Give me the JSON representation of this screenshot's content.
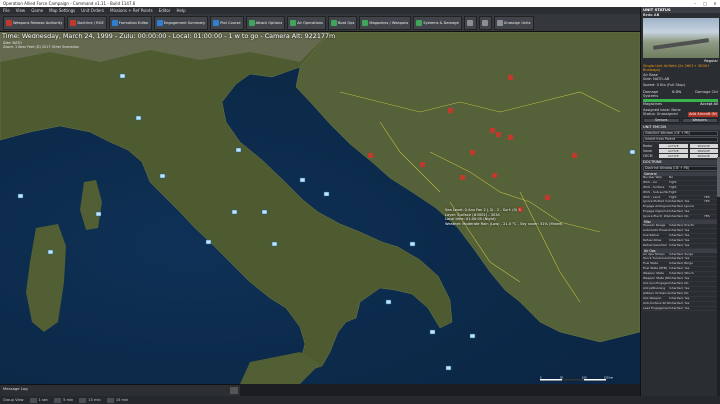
{
  "window": {
    "title": "Operation Allied Force Campaign - Command v1.11 - Build 1147.6",
    "controls": [
      "–",
      "□",
      "✕"
    ]
  },
  "menu": [
    "File",
    "View",
    "Game",
    "Map Settings",
    "Unit Orders",
    "Missions + Ref Points",
    "Editor",
    "Help"
  ],
  "toolbar": {
    "buttons": [
      {
        "label": "Weapons Release Authority",
        "color": "red"
      },
      {
        "label": "Doctrine / ROE",
        "color": "red"
      },
      {
        "label": "Formation Editor",
        "color": "blue"
      },
      {
        "label": "Engagement Summary",
        "color": "blue"
      },
      {
        "label": "Plot Course",
        "color": "blue"
      },
      {
        "label": "Attack Options",
        "color": "green"
      },
      {
        "label": "Air Operations",
        "color": "green"
      },
      {
        "label": "Boat Ops",
        "color": "green"
      },
      {
        "label": "Magazines / Weapons",
        "color": "green"
      },
      {
        "label": "Systems & Damage",
        "color": "green"
      },
      {
        "label": "",
        "color": "gray"
      },
      {
        "label": "",
        "color": "gray"
      },
      {
        "label": "Unassign Units",
        "color": "gray"
      }
    ]
  },
  "map": {
    "status": "Time: Wednesday, March 24, 1999 - Zulu: 00:00:00 - Local: 01:00:00 - 1 w to go - Camera Alt: 922177m",
    "sub_line1": "Side: NATO",
    "sub_line2": "Zoom: 1 Bear Feet (D) 2017 Other Scenarios",
    "tooltip": [
      "Sea Level: 0 Anv Fan 2 (-3) - 2 - Surf: (0) 5",
      "Layer: Surface (#3001) - 3034",
      "Local time: 01:00:00 (Night)",
      "Weather: Moderate Rain (Low) - 21.0 °C - Sky cover: 31% (Mixed)"
    ],
    "scale_labels": [
      "0",
      "50",
      "100",
      "150 km"
    ]
  },
  "message_log": {
    "title": "Message Log"
  },
  "bottombar": {
    "label": "Group View",
    "compression": [
      "1 sec",
      "5 min",
      "15 min",
      "15 min"
    ]
  },
  "unit_panel": {
    "header": "UNIT STATUS",
    "unit_name": "Brdo AB",
    "regular": "Regular",
    "class": "Single-Unit Airfield (2x 2601+ 3000+ Runways)",
    "side": "Air Base",
    "ident": "Side: NATO-AB",
    "status": "Speed: 0 Kts (Full Stop)",
    "damage_label": "Damage",
    "damage_value": "0.0%",
    "damage_detail": "Damage Ctrl",
    "systems_label": "Systems",
    "systems_fraction": 1,
    "magazines_label": "Magazines",
    "magazines_value": "Accept All",
    "assigned_label": "Assigned base: None",
    "status_label": "Status: Unassigned",
    "add_label": "Add Aircraft (N)",
    "sensors_btn": "Sensors",
    "weapons_btn": "Weapons",
    "emcon_header": "UNIT EMCON",
    "emcon_dropdown": "Side/Unit Window (OE + PB)",
    "emcon_rows": [
      {
        "label": "Radar",
        "a": "ACTIVE",
        "b": "PASSIVE"
      },
      {
        "label": "Sonar",
        "a": "ACTIVE",
        "b": "PASSIVE"
      },
      {
        "label": "OECM",
        "a": "ACTIVE",
        "b": "PASSIVE"
      }
    ],
    "emcon_inherit": "Inherit from Parent",
    "doctrine_header": "DOCTRINE",
    "doctrine_dropdown": "Doctrine Window (OE + PB)",
    "doctrine_groups": [
      {
        "title": "General",
        "rows": [
          [
            "Nuclear Wpn",
            "No",
            ""
          ],
          [
            "WCS - Air",
            "Tight",
            ""
          ],
          [
            "WCS - Surface",
            "Tight",
            ""
          ],
          [
            "WCS - Sub-surface",
            "Tight",
            ""
          ],
          [
            "WCS - Land",
            "Tight",
            "YES"
          ],
          [
            "Ignore Plotted Course",
            "Inherited, Yes",
            "YES"
          ],
          [
            "Engage Ambiguous",
            "Inherited, Ignore",
            ""
          ],
          [
            "Engage Opportunity",
            "Inherited, Yes",
            ""
          ],
          [
            "Ignore Electr. Wpns",
            "Inherited, No",
            "YES"
          ]
        ]
      },
      {
        "title": "Misc",
        "rows": [
          [
            "Torpedo Range",
            "Inherited, Practic",
            ""
          ],
          [
            "Automatic Evasion",
            "Inherited, Yes",
            ""
          ],
          [
            "Use Refuel",
            "Inherited, Yes",
            ""
          ],
          [
            "Refuel Allies",
            "Inherited, Yes",
            ""
          ],
          [
            "Refuel Selection",
            "Inherited, Yes",
            ""
          ]
        ]
      },
      {
        "title": "Air Ops",
        "rows": [
          [
            "Air Ops Tempo",
            "Inherited, Surge",
            ""
          ],
          [
            "Quick Turnaround",
            "Inherited, Yes",
            ""
          ],
          [
            "Fuel State",
            "Inherited, Bingo",
            ""
          ],
          [
            "Fuel State (RTB)",
            "Inherited, Yes",
            ""
          ],
          [
            "Weapon State",
            "Inherited, Winch",
            ""
          ],
          [
            "Weapon State (RTB)",
            "Inherited, Yes",
            ""
          ],
          [
            "A/G Gun Engagement",
            "Inherited, No",
            ""
          ],
          [
            "A/G Jettisoning",
            "Inherited, Yes",
            ""
          ],
          [
            "Jettison Ordnance",
            "Inherited, No",
            ""
          ],
          [
            "A/G Weapon",
            "Inherited, Yes",
            ""
          ],
          [
            "Anti-Surface Strike",
            "Inherited, Yes",
            ""
          ],
          [
            "Lead Engagement",
            "Inherited, Yes",
            ""
          ]
        ]
      }
    ]
  }
}
